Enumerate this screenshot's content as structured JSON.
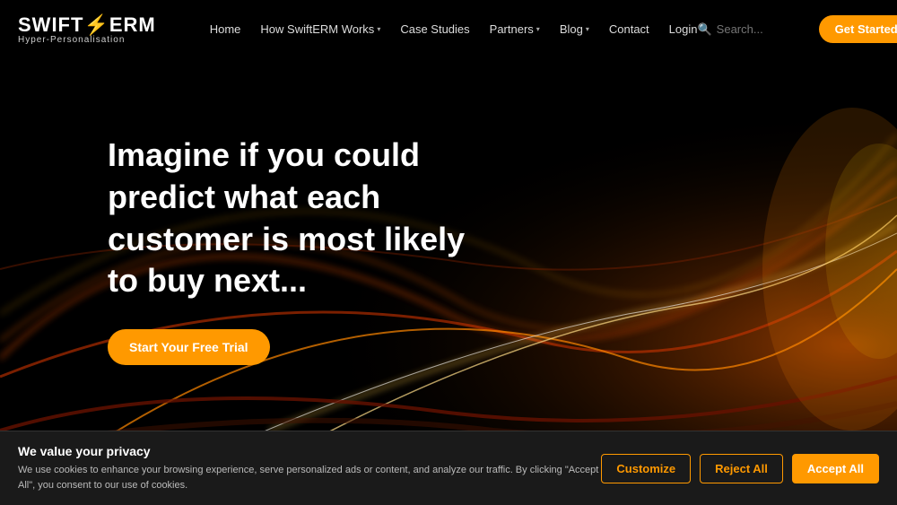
{
  "brand": {
    "name_swift": "SWIFT",
    "name_erm": "ERM",
    "lightning": "⚡",
    "tagline": "Hyper-Personalisation"
  },
  "navbar": {
    "links": [
      {
        "label": "Home",
        "dropdown": false
      },
      {
        "label": "How SwiftERM Works",
        "dropdown": true
      },
      {
        "label": "Case Studies",
        "dropdown": false
      },
      {
        "label": "Partners",
        "dropdown": true
      },
      {
        "label": "Blog",
        "dropdown": true
      },
      {
        "label": "Contact",
        "dropdown": false
      },
      {
        "label": "Login",
        "dropdown": false
      }
    ],
    "search_placeholder": "Search...",
    "cta_label": "Get Started"
  },
  "hero": {
    "title": "Imagine if you could predict what each customer is most likely to buy next...",
    "cta_label": "Start Your Free Trial"
  },
  "cookie": {
    "title": "We value your privacy",
    "body": "We use cookies to enhance your browsing experience, serve personalized ads or content, and analyze our traffic. By clicking \"Accept All\", you consent to our use of cookies.",
    "btn_customize": "Customize",
    "btn_reject": "Reject All",
    "btn_accept": "Accept All"
  }
}
